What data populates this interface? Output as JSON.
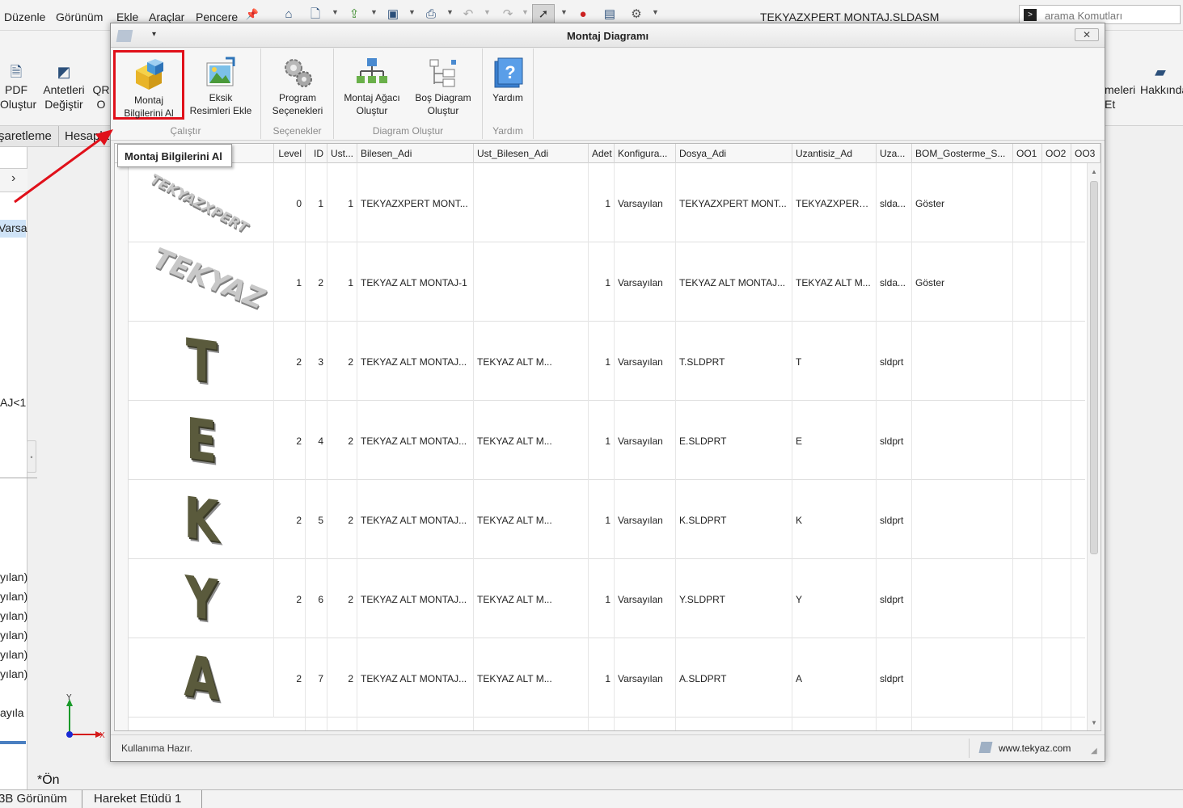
{
  "app": {
    "menu": [
      "Düzenle",
      "Görünüm",
      "Ekle",
      "Araçlar",
      "Pencere"
    ],
    "title": "TEKYAZXPERT MONTAJ.SLDASM",
    "search_placeholder": "arama Komutları",
    "toolbar_left": [
      {
        "line1": "PDF",
        "line2": "Oluştur"
      },
      {
        "line1": "Antetleri",
        "line2": "Değiştir"
      },
      {
        "line1": "QR",
        "line2": "O"
      }
    ],
    "toolbar_right": [
      {
        "line1": "meleri",
        "line2": "Et"
      },
      {
        "line1": "Hakkında",
        "line2": ""
      }
    ],
    "cm_tabs": [
      "şaretleme",
      "Hesapla"
    ],
    "tree": {
      "selected": "Varsa",
      "item2": "AJ<1",
      "config_items": [
        "yılan)",
        "yılan)",
        "yılan)",
        "yılan)",
        "yılan)",
        "yılan)"
      ],
      "item_last": "ayıla"
    },
    "view_label": "*Ön",
    "triad": {
      "y": "Y",
      "x": "X"
    },
    "bottom_tabs": [
      "3B Görünüm",
      "Hareket Etüdü 1"
    ]
  },
  "dialog": {
    "title": "Montaj Diagramı",
    "close": "✕",
    "ribbon": {
      "groups": [
        {
          "label": "Çalıştır",
          "buttons": [
            {
              "line1": "Montaj",
              "line2": "Bilgilerini Al",
              "icon": "cube-icon"
            },
            {
              "line1": "Eksik",
              "line2": "Resimleri Ekle",
              "icon": "picture-add-icon"
            }
          ]
        },
        {
          "label": "Seçenekler",
          "buttons": [
            {
              "line1": "Program",
              "line2": "Seçenekleri",
              "icon": "gears-icon"
            }
          ]
        },
        {
          "label": "Diagram Oluştur",
          "buttons": [
            {
              "line1": "Montaj Ağacı",
              "line2": "Oluştur",
              "icon": "tree-icon"
            },
            {
              "line1": "Boş Diagram",
              "line2": "Oluştur",
              "icon": "blank-tree-icon"
            }
          ]
        },
        {
          "label": "Yardım",
          "buttons": [
            {
              "line1": "Yardım",
              "line2": "",
              "icon": "help-icon"
            }
          ]
        }
      ]
    },
    "tooltip": "Montaj Bilgilerini Al",
    "grid": {
      "columns": [
        "",
        "Level",
        "ID",
        "Ust...",
        "Bilesen_Adi",
        "Ust_Bilesen_Adi",
        "Adet",
        "Konfigura...",
        "Dosya_Adi",
        "Uzantisiz_Ad",
        "Uza...",
        "BOM_Gosterme_S...",
        "OO1",
        "OO2",
        "OO3"
      ],
      "rows": [
        {
          "pic": "TEKYAZXPERT",
          "level": "0",
          "id": "1",
          "ust": "1",
          "bilesen": "TEKYAZXPERT MONT...",
          "ust_bilesen": "",
          "adet": "1",
          "konfig": "Varsayılan",
          "dosya": "TEKYAZXPERT MONT...",
          "uzantisiz": "TEKYAZXPERT ...",
          "uza": "slda...",
          "bom": "Göster"
        },
        {
          "pic": "TEKYAZ",
          "level": "1",
          "id": "2",
          "ust": "1",
          "bilesen": "TEKYAZ ALT MONTAJ-1",
          "ust_bilesen": "",
          "adet": "1",
          "konfig": "Varsayılan",
          "dosya": "TEKYAZ ALT MONTAJ...",
          "uzantisiz": "TEKYAZ ALT M...",
          "uza": "slda...",
          "bom": "Göster"
        },
        {
          "pic": "T",
          "level": "2",
          "id": "3",
          "ust": "2",
          "bilesen": "TEKYAZ ALT MONTAJ...",
          "ust_bilesen": "TEKYAZ ALT M...",
          "adet": "1",
          "konfig": "Varsayılan",
          "dosya": "T.SLDPRT",
          "uzantisiz": "T",
          "uza": "sldprt",
          "bom": ""
        },
        {
          "pic": "E",
          "level": "2",
          "id": "4",
          "ust": "2",
          "bilesen": "TEKYAZ ALT MONTAJ...",
          "ust_bilesen": "TEKYAZ ALT M...",
          "adet": "1",
          "konfig": "Varsayılan",
          "dosya": "E.SLDPRT",
          "uzantisiz": "E",
          "uza": "sldprt",
          "bom": ""
        },
        {
          "pic": "K",
          "level": "2",
          "id": "5",
          "ust": "2",
          "bilesen": "TEKYAZ ALT MONTAJ...",
          "ust_bilesen": "TEKYAZ ALT M...",
          "adet": "1",
          "konfig": "Varsayılan",
          "dosya": "K.SLDPRT",
          "uzantisiz": "K",
          "uza": "sldprt",
          "bom": ""
        },
        {
          "pic": "Y",
          "level": "2",
          "id": "6",
          "ust": "2",
          "bilesen": "TEKYAZ ALT MONTAJ...",
          "ust_bilesen": "TEKYAZ ALT M...",
          "adet": "1",
          "konfig": "Varsayılan",
          "dosya": "Y.SLDPRT",
          "uzantisiz": "Y",
          "uza": "sldprt",
          "bom": ""
        },
        {
          "pic": "A",
          "level": "2",
          "id": "7",
          "ust": "2",
          "bilesen": "TEKYAZ ALT MONTAJ...",
          "ust_bilesen": "TEKYAZ ALT M...",
          "adet": "1",
          "konfig": "Varsayılan",
          "dosya": "A.SLDPRT",
          "uzantisiz": "A",
          "uza": "sldprt",
          "bom": ""
        }
      ]
    },
    "status": {
      "text": "Kullanıma Hazır.",
      "link": "www.tekyaz.com"
    }
  },
  "colors": {
    "highlight": "#e0101a",
    "arrow": "#e0101a"
  }
}
